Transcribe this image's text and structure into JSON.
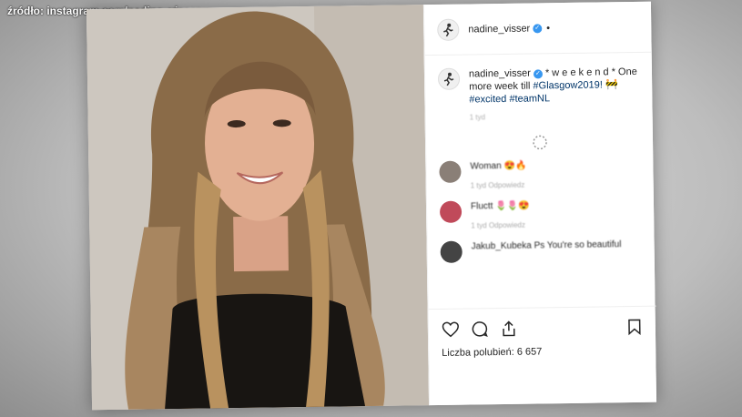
{
  "source_caption": "źródło: instagram.com/nadine_visser",
  "post": {
    "username": "nadine_visser",
    "header_extra": "•",
    "caption_user": "nadine_visser",
    "caption_text": "* w e e k e n d * One more week till ",
    "hashtags": [
      "#Glasgow2019!",
      "#excited",
      "#teamNL"
    ],
    "caption_emoji": "🚧",
    "caption_meta": "1 tyd",
    "likes_label": "Liczba polubień:",
    "likes_count": "6 657"
  },
  "comments": [
    {
      "user": "",
      "text": "Woman 😍🔥",
      "meta": "1 tyd  Odpowiedz",
      "avatar_color": "#8a7f77"
    },
    {
      "user": "",
      "text": "Fluctt 🌷🌷😍",
      "meta": "1 tyd  Odpowiedz",
      "avatar_color": "#c04a5a"
    },
    {
      "user": "Jakub_Kubeka",
      "text": "Ps You're so beautiful",
      "meta": "",
      "avatar_color": "#444444"
    }
  ],
  "colors": {
    "verified": "#3897f0",
    "hashtag": "#003569",
    "text": "#262626"
  },
  "icons": [
    "heart-icon",
    "comment-icon",
    "share-icon",
    "bookmark-icon"
  ]
}
